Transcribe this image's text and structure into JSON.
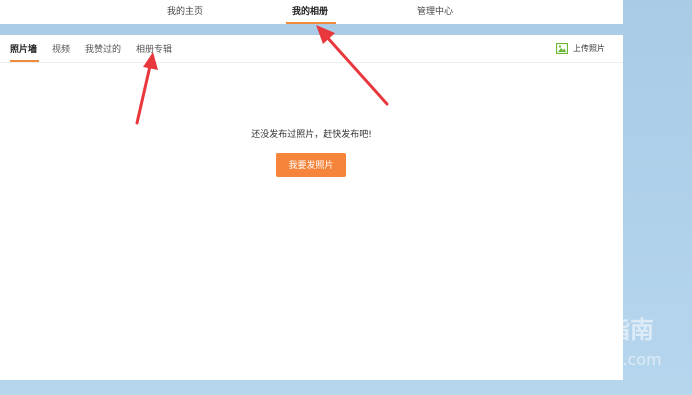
{
  "top_nav": {
    "items": [
      {
        "label": "我的主页"
      },
      {
        "label": "我的相册",
        "active": true
      },
      {
        "label": "管理中心"
      }
    ]
  },
  "sub_tabs": [
    {
      "label": "照片墙",
      "active": true
    },
    {
      "label": "视频"
    },
    {
      "label": "我赞过的"
    },
    {
      "label": "相册专辑"
    }
  ],
  "upload": {
    "label": "上传照片",
    "icon": "image-upload-icon"
  },
  "empty_state": {
    "message": "还没发布过照片，赶快发布吧!",
    "button_label": "我要发照片"
  },
  "watermark": {
    "brand": "搜狗指南",
    "url": "zhinan.sogou.com"
  },
  "colors": {
    "accent": "#f08a3c",
    "button": "#f6843a",
    "background": "#b0d2ec",
    "arrow": "#e8383d",
    "upload_icon": "#6bb834"
  }
}
